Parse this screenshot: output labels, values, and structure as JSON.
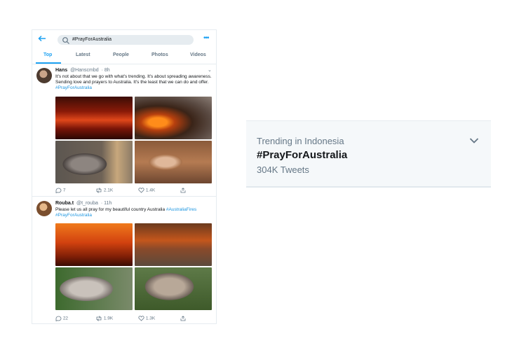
{
  "search": {
    "query": "#PrayForAustralia"
  },
  "tabs": [
    {
      "label": "Top"
    },
    {
      "label": "Latest"
    },
    {
      "label": "People"
    },
    {
      "label": "Photos"
    },
    {
      "label": "Videos"
    }
  ],
  "tweets": [
    {
      "name": "Hans",
      "handle": "@Hanscmbd",
      "time": "· 8h",
      "text": "It's not about that we go with what's trending. It's about spreading awareness. Sending love and prayers to Australia. It's the least that we can do and offer.",
      "hashtags": "#PrayForAustralia",
      "replies": "7",
      "retweets": "2.1K",
      "likes": "1.4K"
    },
    {
      "name": "Rouba.t",
      "handle": "@t_rouba",
      "time": "· 11h",
      "text": "Please let us all pray for my beautiful country Australia",
      "hashtag_inline": "#AustraliaFires",
      "hashtags": "#PrayForAustralia",
      "replies": "22",
      "retweets": "1.9K",
      "likes": "1.3K"
    }
  ],
  "trend": {
    "context": "Trending in Indonesia",
    "title": "#PrayForAustralia",
    "count": "304K Tweets"
  },
  "colors": {
    "accent": "#1da1f2",
    "muted": "#657786",
    "fire": "#d4361a"
  }
}
